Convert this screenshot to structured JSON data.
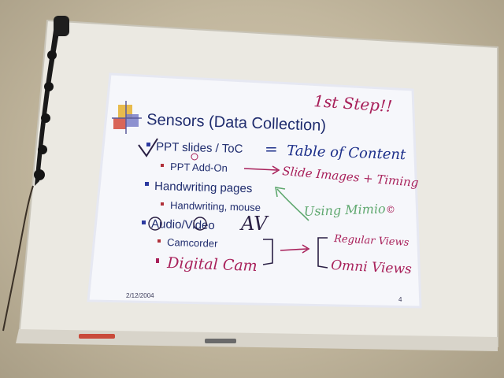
{
  "slide": {
    "title": "Sensors (Data Collection)",
    "bullets": [
      {
        "text": "PPT slides / ToC",
        "level": 1
      },
      {
        "text": "PPT Add-On",
        "level": 2
      },
      {
        "text": "Handwriting pages",
        "level": 1
      },
      {
        "text": "Handwriting, mouse",
        "level": 2
      },
      {
        "text": "Audio/Video",
        "level": 1
      },
      {
        "text": "Camcorder",
        "level": 2
      }
    ],
    "date": "2/12/2004",
    "page_number": "4"
  },
  "ink": {
    "first_step": "1st Step!!",
    "equals": "=",
    "table_of_content": "Table of Content",
    "slide_images": "Slide Images + Timing",
    "using_mimio": "Using Mimio",
    "circled_c": "©",
    "av": "AV",
    "digital_cam": "Digital Cam",
    "regular_views": "Regular Views",
    "omni_views": "Omni Views"
  },
  "colors": {
    "ink_purple": "#a8205a",
    "ink_blue": "#1c2f8a",
    "ink_green": "#5fa86f",
    "ink_dark": "#2a1f44",
    "slide_text": "#1f2c6e"
  }
}
